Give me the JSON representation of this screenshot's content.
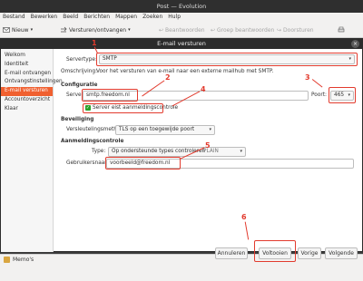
{
  "window": {
    "title": "Post — Evolution",
    "menu": [
      "Bestand",
      "Bewerken",
      "Beeld",
      "Berichten",
      "Mappen",
      "Zoeken",
      "Hulp"
    ],
    "toolbar": {
      "new_label": "Nieuw",
      "send_receive_label": "Versturen/ontvangen",
      "reply_label": "Beantwoorden",
      "reply_group_label": "Groep beantwoorden",
      "forward_label": "Doorsturen"
    },
    "memo_label": "Memo's"
  },
  "dialog": {
    "title": "E-mail versturen",
    "close_label": "×",
    "sidebar_items": [
      {
        "label": "Welkom",
        "active": false
      },
      {
        "label": "Identiteit",
        "active": false
      },
      {
        "label": "E-mail ontvangen",
        "active": false
      },
      {
        "label": "Ontvangstinstellingen",
        "active": false
      },
      {
        "label": "E-mail versturen",
        "active": true
      },
      {
        "label": "Accountoverzicht",
        "active": false
      },
      {
        "label": "Klaar",
        "active": false
      }
    ],
    "server_type_label": "Servertype:",
    "server_type_value": "SMTP",
    "description_label": "Omschrijving:",
    "description_text": "Voor het versturen van e-mail naar een externe mailhub met SMTP.",
    "configuration_heading": "Configuratie",
    "server_label": "Server:",
    "server_value": "smtp.freedom.nl",
    "port_label": "Poort:",
    "port_value": "465",
    "auth_required_label": "Server eist aanmeldingscontrole",
    "auth_required_checked": true,
    "security_heading": "Beveiliging",
    "encryption_label": "Versleutelingsmethode:",
    "encryption_value": "TLS op een toegewijde poort",
    "authentication_heading": "Aanmeldingscontrole",
    "type_label": "Type:",
    "type_value": "Op ondersteunde types controleren",
    "type_secondary": "PLAIN",
    "username_label": "Gebruikersnaam:",
    "username_value": "voorbeeld@freedom.nl",
    "buttons": {
      "cancel": "Annuleren",
      "finish": "Voltooien",
      "previous": "Vorige",
      "next": "Volgende"
    },
    "annotations": [
      "1",
      "2",
      "3",
      "4",
      "5",
      "6"
    ],
    "annotation_color": "#e23b2e",
    "accent_color": "#f06030"
  }
}
